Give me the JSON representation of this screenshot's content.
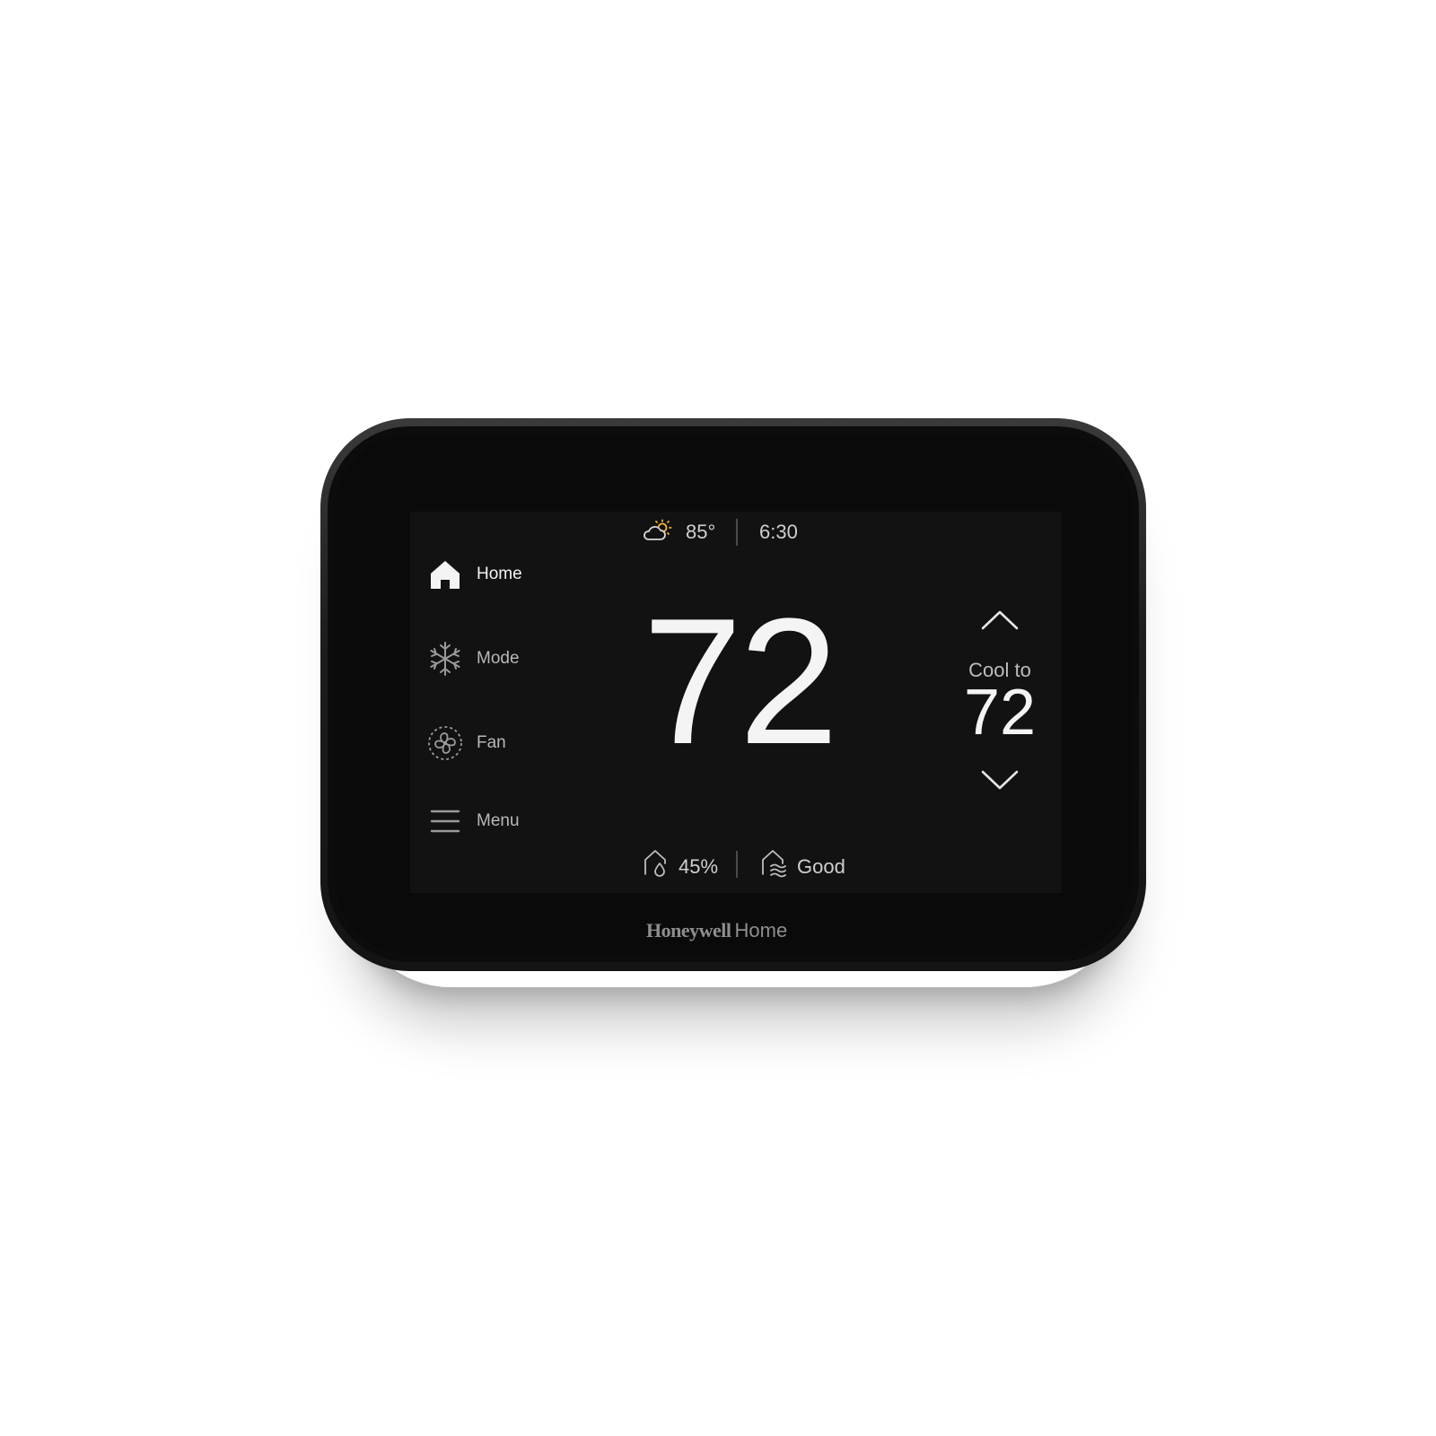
{
  "top_status": {
    "weather_icon": "partly-sunny-icon",
    "outdoor_temp": "85°",
    "time": "6:30"
  },
  "sidebar": {
    "items": [
      {
        "label": "Home",
        "icon": "home-icon",
        "active": true
      },
      {
        "label": "Mode",
        "icon": "snowflake-icon",
        "active": false
      },
      {
        "label": "Fan",
        "icon": "fan-icon",
        "active": false
      },
      {
        "label": "Menu",
        "icon": "hamburger-icon",
        "active": false
      }
    ]
  },
  "main": {
    "indoor_temp": "72"
  },
  "setpoint": {
    "label": "Cool to",
    "value": "72",
    "up_icon": "chevron-up-icon",
    "down_icon": "chevron-down-icon"
  },
  "bottom_status": {
    "humidity_icon": "humidity-icon",
    "humidity": "45%",
    "air_quality_icon": "air-quality-icon",
    "air_quality": "Good"
  },
  "brand": {
    "name": "Honeywell",
    "suffix": "Home"
  },
  "colors": {
    "screen": "#121212",
    "text_primary": "#f4f4f4",
    "text_secondary": "#bdbdbd",
    "sun": "#f2b233"
  }
}
